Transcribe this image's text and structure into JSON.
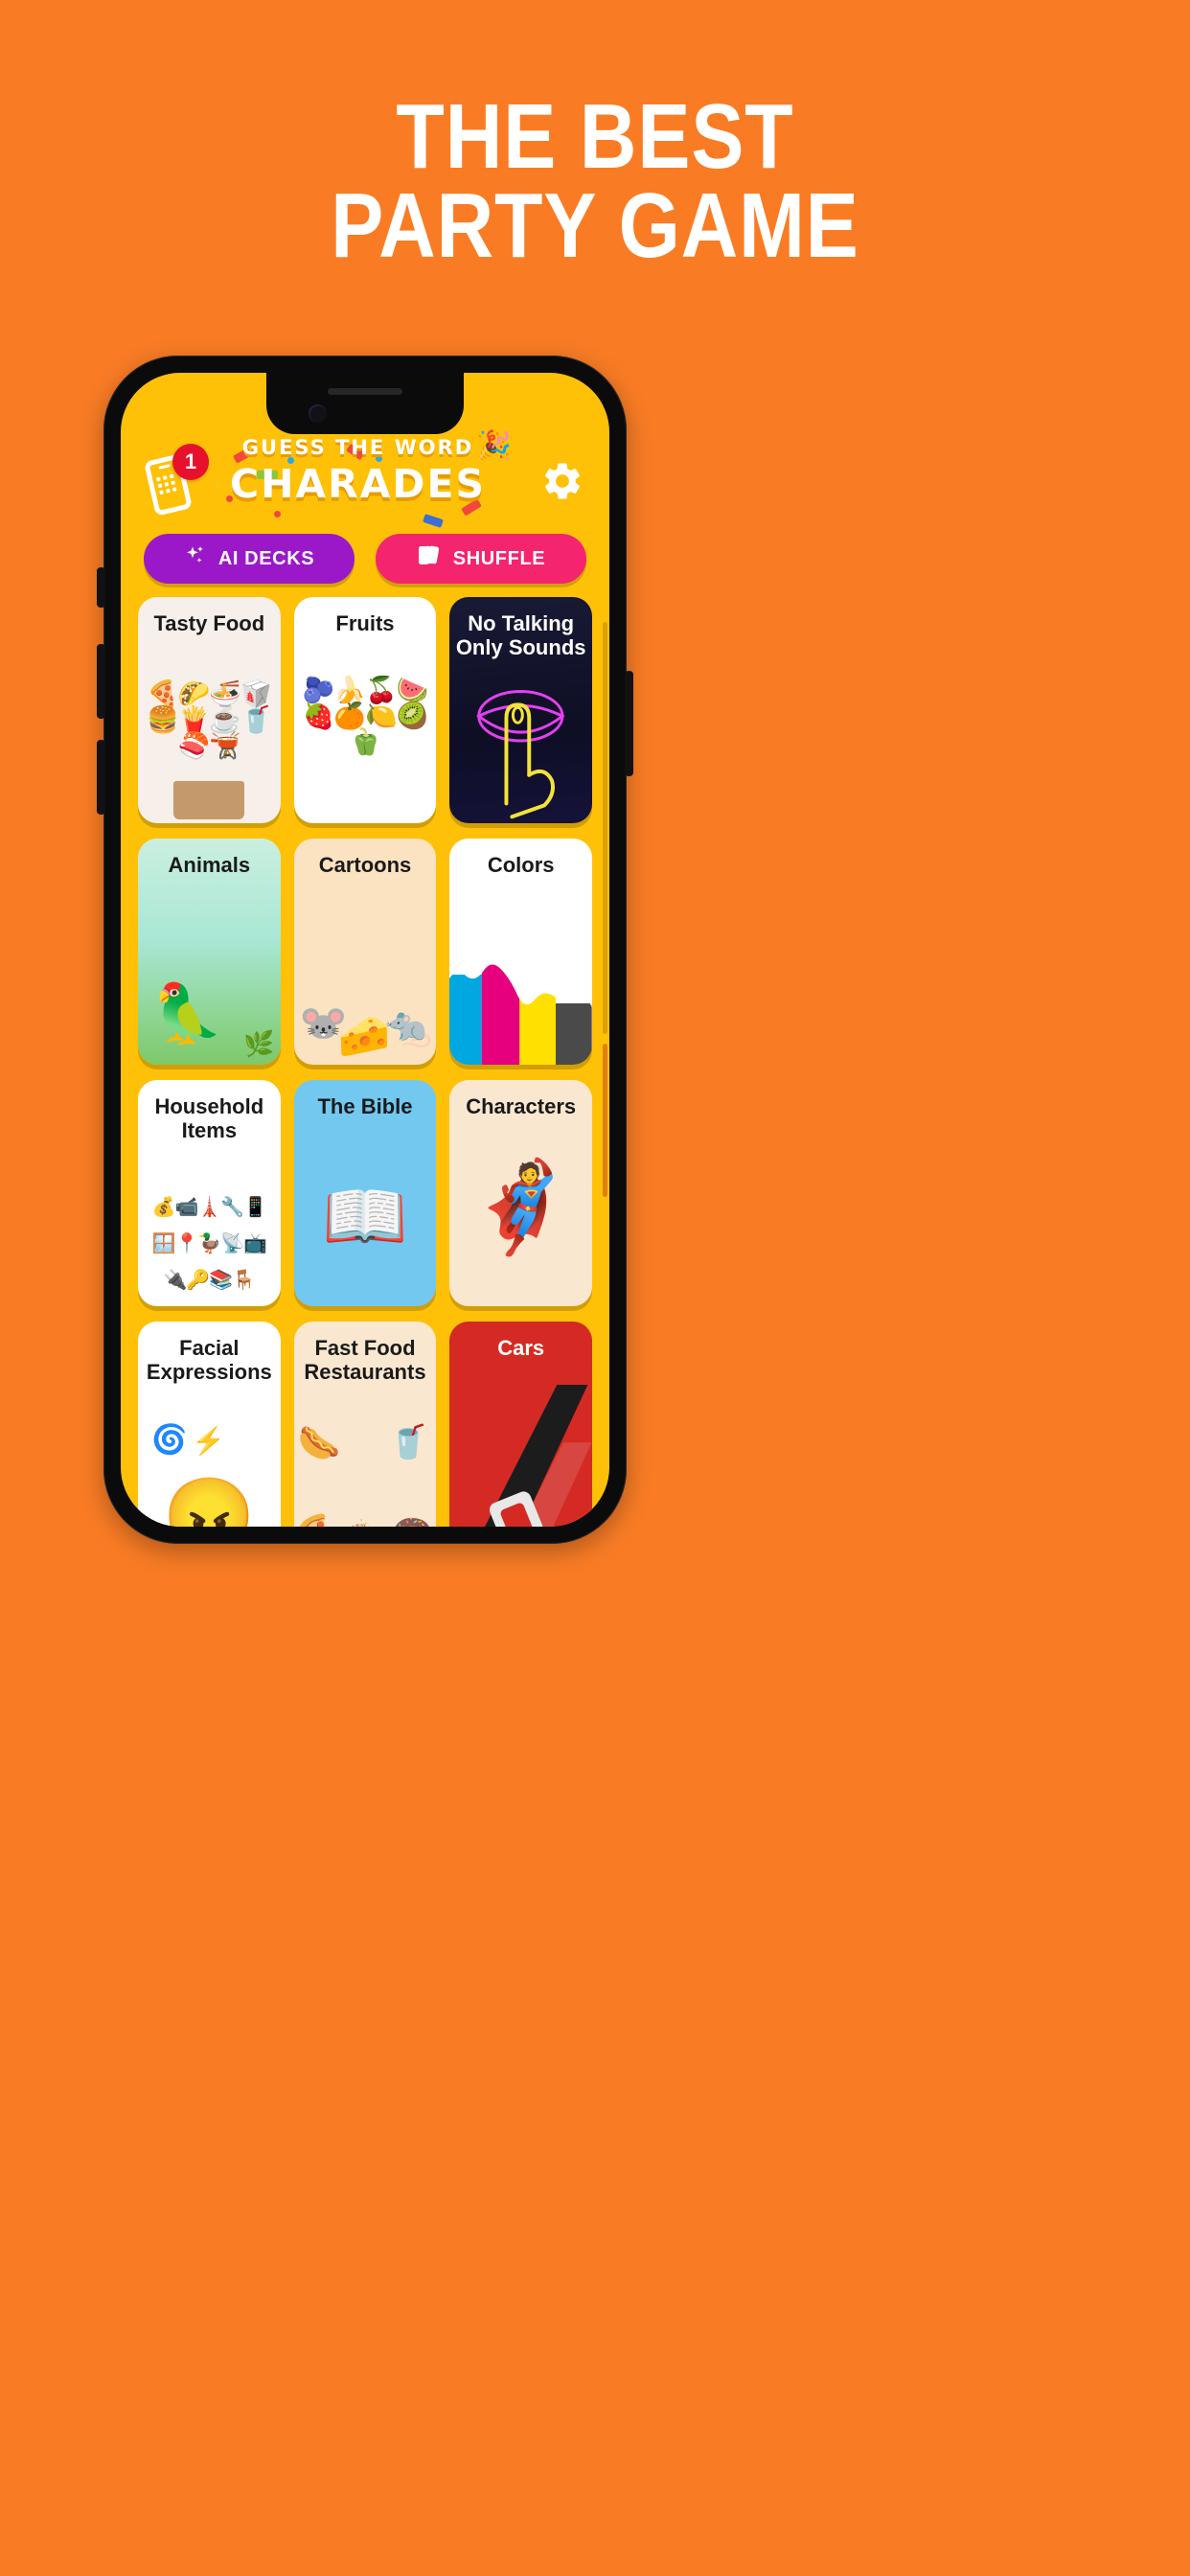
{
  "promo": {
    "headline_line1": "THE BEST",
    "headline_line2": "PARTY GAME",
    "background_color": "#F97C25",
    "text_color": "#FFFFFF"
  },
  "device": {
    "frame_color": "#0B0B0C",
    "screen_background": "#FFC107"
  },
  "app": {
    "header": {
      "badge_count": "1",
      "phone_icon": "phone-notification-icon",
      "logo_top": "GUESS THE WORD",
      "logo_main": "CHARADES",
      "logo_emoji": "🎉",
      "settings_icon": "gear-icon"
    },
    "actions": [
      {
        "label": "AI DECKS",
        "icon": "sparkles-icon",
        "color": "#9B18C8"
      },
      {
        "label": "SHUFFLE",
        "icon": "cards-icon",
        "color": "#F4246E"
      }
    ],
    "decks": [
      {
        "title": "Tasty Food",
        "bg": "#F7F0EA",
        "title_color": "#1A1A1A",
        "art": "🍕🌮🍜🥡🍔🍟☕🥤🍣🫕"
      },
      {
        "title": "Fruits",
        "bg": "#FFFFFF",
        "title_color": "#1A1A1A",
        "art": "🫐🍌🍒🍉🍓🍊🍋🥝🫑"
      },
      {
        "title": "No Talking\nOnly Sounds",
        "bg": "#141436",
        "title_color": "#FFFFFF",
        "art": "👄🤫"
      },
      {
        "title": "Animals",
        "bg": "#BDEBDC",
        "title_color": "#1A1A1A",
        "art": "🦜🌴🌿"
      },
      {
        "title": "Cartoons",
        "bg": "#FBE3C2",
        "title_color": "#1A1A1A",
        "art": "🐭🧀🐁"
      },
      {
        "title": "Colors",
        "bg": "#FFFFFF",
        "title_color": "#1A1A1A",
        "art": "colors-drip"
      },
      {
        "title": "Household\nItems",
        "bg": "#FFFFFF",
        "title_color": "#1A1A1A",
        "art": "💰📹🗼🔧📱🪟📍🦆📡📺🔌🔑📚🪑"
      },
      {
        "title": "The Bible",
        "bg": "#73C8F0",
        "title_color": "#1A1A1A",
        "art": "📖"
      },
      {
        "title": "Characters",
        "bg": "#FAE7CF",
        "title_color": "#1A1A1A",
        "art": "🦸"
      },
      {
        "title": "Facial\nExpressions",
        "bg": "#FFFFFF",
        "title_color": "#1A1A1A",
        "art": "😡⚡👩"
      },
      {
        "title": "Fast Food\nRestaurants",
        "bg": "#FAE7D0",
        "title_color": "#1A1A1A",
        "art": "🌭🥤🍕🧁🍩"
      },
      {
        "title": "Cars",
        "bg": "#D42A23",
        "title_color": "#FFFFFF",
        "art": "🚗"
      }
    ]
  }
}
